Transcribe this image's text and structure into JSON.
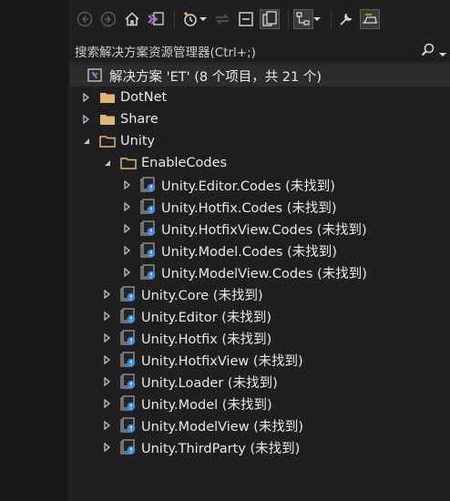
{
  "toolbar": {
    "buttons": [
      "back-icon",
      "forward-icon",
      "home-icon",
      "vs-switch-icon",
      "history-icon",
      "sync-icon",
      "collapse-all-icon",
      "show-all-files-icon",
      "view-tree-icon",
      "properties-icon",
      "preview-icon"
    ]
  },
  "search": {
    "placeholder": "搜索解决方案资源管理器(Ctrl+;)"
  },
  "solution": {
    "label": "解决方案 'ET' (8 个项目，共 21 个)"
  },
  "tree": {
    "dotnet": "DotNet",
    "share": "Share",
    "unity": "Unity",
    "enablecodes": "EnableCodes",
    "ec_items": [
      "Unity.Editor.Codes (未找到)",
      "Unity.Hotfix.Codes (未找到)",
      "Unity.HotfixView.Codes (未找到)",
      "Unity.Model.Codes (未找到)",
      "Unity.ModelView.Codes (未找到)"
    ],
    "unity_items": [
      "Unity.Core (未找到)",
      "Unity.Editor (未找到)",
      "Unity.Hotfix (未找到)",
      "Unity.HotfixView (未找到)",
      "Unity.Loader (未找到)",
      "Unity.Model (未找到)",
      "Unity.ModelView (未找到)",
      "Unity.ThirdParty (未找到)"
    ]
  },
  "colors": {
    "background": "#1f1f1f",
    "folder": "#dcb67a",
    "project_blue": "#3c8ce0",
    "warning": "#e0b33c",
    "vs_purple": "#a074c4"
  }
}
